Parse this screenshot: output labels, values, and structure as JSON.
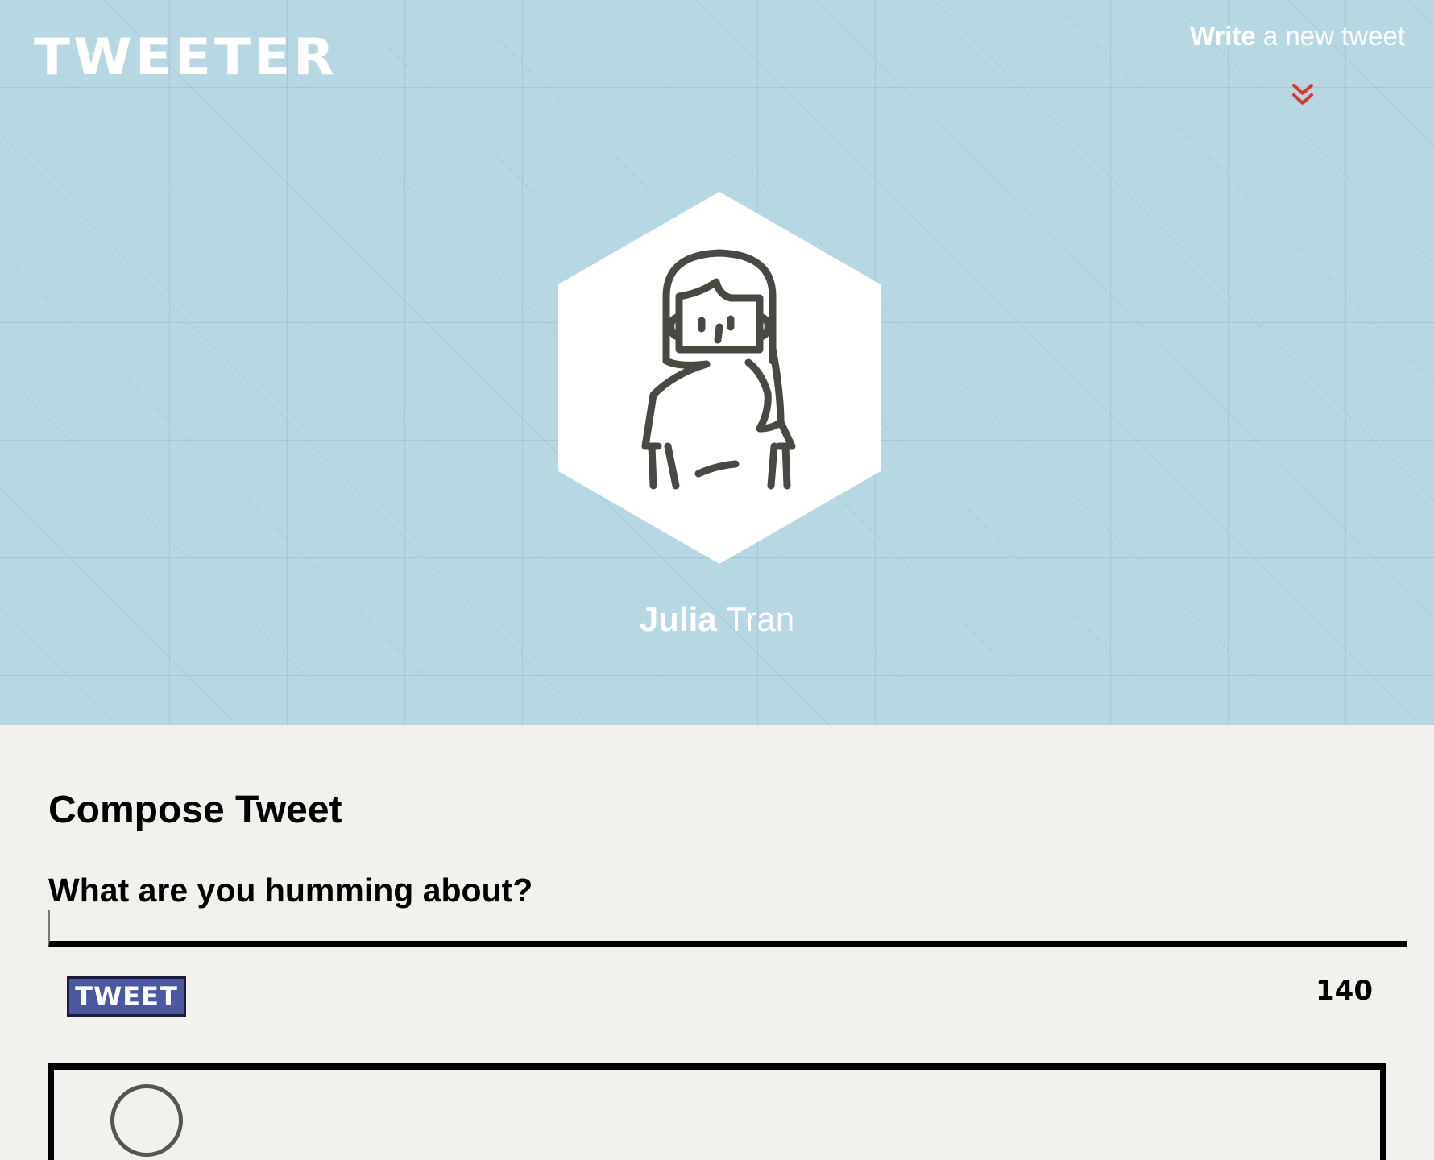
{
  "header": {
    "logo": "TWEETER",
    "write_bold": "Write",
    "write_rest": " a new tweet",
    "chevron_icon": "double-chevron-down-icon",
    "chevron_color": "#e0352b",
    "background_color": "#b7d7e2"
  },
  "profile": {
    "first_name": "Julia",
    "last_name": "Tran",
    "avatar_icon": "woman-avatar-icon"
  },
  "compose": {
    "title": "Compose Tweet",
    "question": "What are you humming about?",
    "input_value": "",
    "button_label": "TWEET",
    "counter": "140",
    "button_color": "#4a58a0"
  }
}
